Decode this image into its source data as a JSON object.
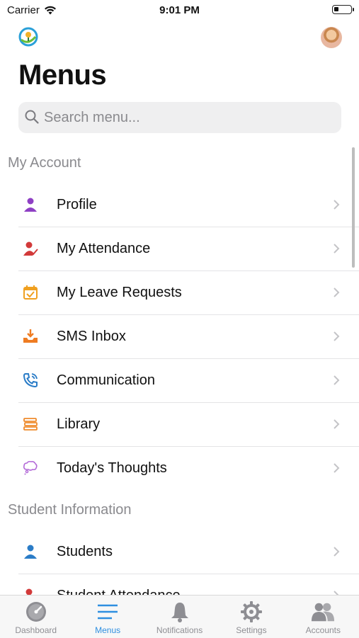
{
  "status": {
    "carrier": "Carrier",
    "time": "9:01 PM",
    "battery_level": 0.3
  },
  "header": {
    "title": "Menus"
  },
  "search": {
    "placeholder": "Search menu..."
  },
  "sections": [
    {
      "title": "My Account",
      "items": [
        {
          "label": "Profile",
          "icon": "profile-icon",
          "color": "#8e3fc4"
        },
        {
          "label": "My Attendance",
          "icon": "attendance-icon",
          "color": "#d23a3a"
        },
        {
          "label": "My Leave Requests",
          "icon": "calendar-check-icon",
          "color": "#f0a020"
        },
        {
          "label": "SMS Inbox",
          "icon": "inbox-icon",
          "color": "#ef7c22"
        },
        {
          "label": "Communication",
          "icon": "phone-icon",
          "color": "#2a7cc7"
        },
        {
          "label": "Library",
          "icon": "books-icon",
          "color": "#ef8b2c"
        },
        {
          "label": "Today's Thoughts",
          "icon": "thought-bubble-icon",
          "color": "#b36ad8"
        }
      ]
    },
    {
      "title": "Student Information",
      "items": [
        {
          "label": "Students",
          "icon": "student-icon",
          "color": "#2a7cc7"
        },
        {
          "label": "Student Attendance",
          "icon": "student-attendance-icon",
          "color": "#d23a3a"
        }
      ]
    }
  ],
  "tabs": [
    {
      "label": "Dashboard",
      "icon": "dashboard-gauge-icon",
      "active": false
    },
    {
      "label": "Menus",
      "icon": "menu-lines-icon",
      "active": true
    },
    {
      "label": "Notifications",
      "icon": "bell-icon",
      "active": false
    },
    {
      "label": "Settings",
      "icon": "gear-icon",
      "active": false
    },
    {
      "label": "Accounts",
      "icon": "accounts-icon",
      "active": false
    }
  ],
  "colors": {
    "accent": "#2f8fe0",
    "inactive": "#8e8e93"
  }
}
